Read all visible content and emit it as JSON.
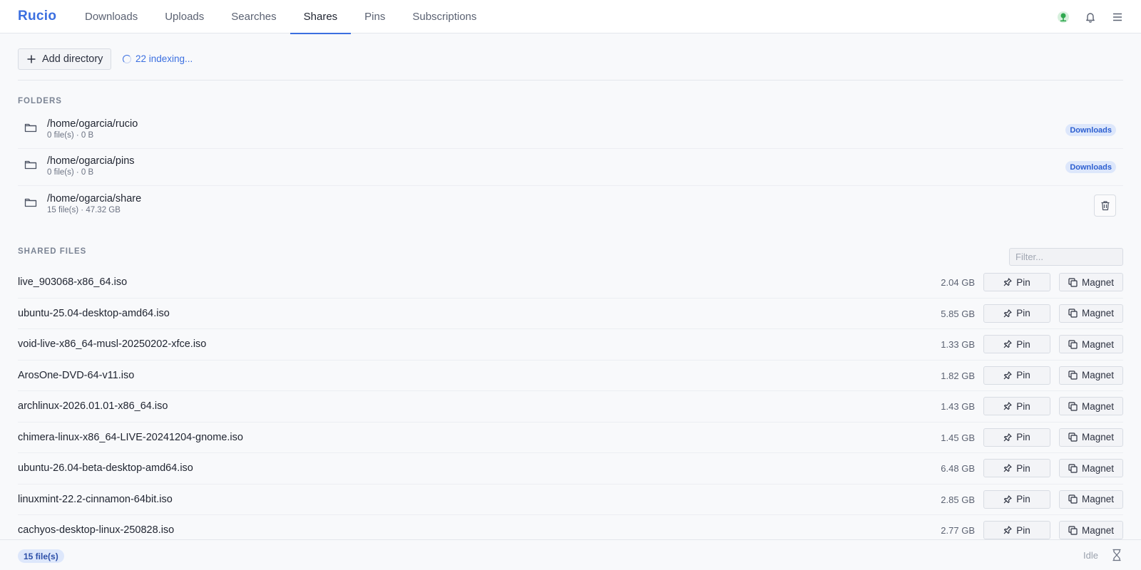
{
  "app": {
    "brand": "Rucio"
  },
  "nav": {
    "tabs": [
      {
        "label": "Downloads",
        "active": false
      },
      {
        "label": "Uploads",
        "active": false
      },
      {
        "label": "Searches",
        "active": false
      },
      {
        "label": "Shares",
        "active": true
      },
      {
        "label": "Pins",
        "active": false
      },
      {
        "label": "Subscriptions",
        "active": false
      }
    ],
    "icons": [
      "network-status-icon",
      "bell-icon",
      "menu-icon"
    ]
  },
  "toolbar": {
    "add_directory_label": "Add directory",
    "indexing_text": "22 indexing..."
  },
  "folders_section": {
    "title": "FOLDERS",
    "items": [
      {
        "path": "/home/ogarcia/rucio",
        "meta": "0 file(s) · 0 B",
        "badge": "Downloads",
        "action": ""
      },
      {
        "path": "/home/ogarcia/pins",
        "meta": "0 file(s) · 0 B",
        "badge": "Downloads",
        "action": ""
      },
      {
        "path": "/home/ogarcia/share",
        "meta": "15 file(s) · 47.32 GB",
        "badge": "",
        "action": "trash-icon"
      }
    ]
  },
  "shared_files_section": {
    "title": "SHARED FILES",
    "filter_placeholder": "Filter...",
    "pin_label": "Pin",
    "magnet_label": "Magnet",
    "files": [
      {
        "name": "live_903068-x86_64.iso",
        "size": "2.04 GB"
      },
      {
        "name": "ubuntu-25.04-desktop-amd64.iso",
        "size": "5.85 GB"
      },
      {
        "name": "void-live-x86_64-musl-20250202-xfce.iso",
        "size": "1.33 GB"
      },
      {
        "name": "ArosOne-DVD-64-v11.iso",
        "size": "1.82 GB"
      },
      {
        "name": "archlinux-2026.01.01-x86_64.iso",
        "size": "1.43 GB"
      },
      {
        "name": "chimera-linux-x86_64-LIVE-20241204-gnome.iso",
        "size": "1.45 GB"
      },
      {
        "name": "ubuntu-26.04-beta-desktop-amd64.iso",
        "size": "6.48 GB"
      },
      {
        "name": "linuxmint-22.2-cinnamon-64bit.iso",
        "size": "2.85 GB"
      },
      {
        "name": "cachyos-desktop-linux-250828.iso",
        "size": "2.77 GB"
      }
    ]
  },
  "statusbar": {
    "file_count": "15 file(s)",
    "status": "Idle"
  },
  "colors": {
    "accent": "#3b6fe0",
    "badge_bg": "#dde7fb",
    "network_ok": "#2fa84f"
  }
}
